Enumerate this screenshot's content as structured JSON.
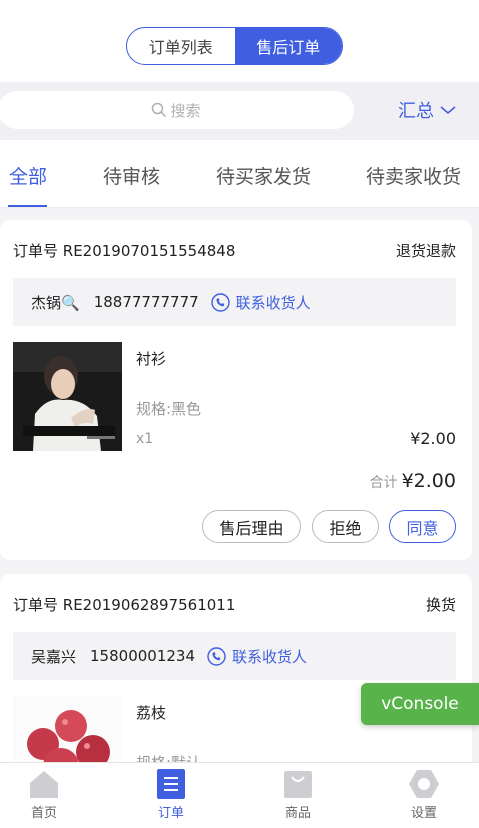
{
  "segment": {
    "tabs": [
      "订单列表",
      "售后订单"
    ],
    "active_index": 1
  },
  "search": {
    "placeholder": "搜索",
    "summary_label": "汇总"
  },
  "status_tabs": [
    "全部",
    "待审核",
    "待买家发货",
    "待卖家收货"
  ],
  "orders": [
    {
      "order_no": "订单号 RE2019070151554848",
      "type": "退货退款",
      "buyer_name": "杰锅🔍",
      "phone": "18877777777",
      "contact_label": "联系收货人",
      "product_name": "衬衫",
      "spec": "规格:黑色",
      "qty": "x1",
      "price": "¥2.00",
      "total_label": "合计",
      "total": "¥2.00",
      "actions": [
        "售后理由",
        "拒绝",
        "同意"
      ]
    },
    {
      "order_no": "订单号 RE2019062897561011",
      "type": "换货",
      "buyer_name": "吴嘉兴",
      "phone": "15800001234",
      "contact_label": "联系收货人",
      "product_name": "荔枝",
      "spec": "规格:默认"
    }
  ],
  "vconsole_label": "vConsole",
  "tabbar": [
    {
      "label": "首页",
      "icon": "home-icon"
    },
    {
      "label": "订单",
      "icon": "order-icon",
      "active": true
    },
    {
      "label": "商品",
      "icon": "bag-icon"
    },
    {
      "label": "设置",
      "icon": "gear-icon"
    }
  ],
  "colors": {
    "accent": "#3f5fe0",
    "vconsole": "#58b34a"
  }
}
